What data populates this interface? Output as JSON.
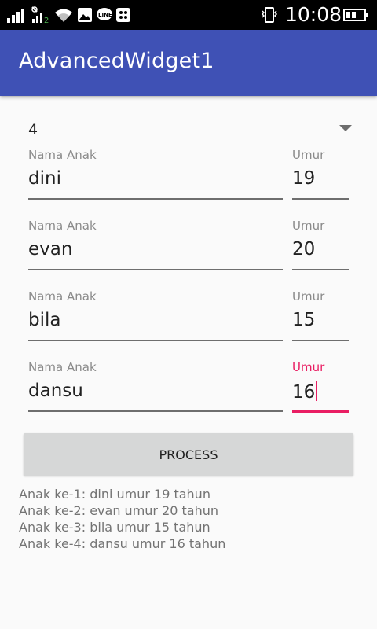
{
  "statusbar": {
    "time": "10:08",
    "icons": [
      "signal-icon",
      "signal-2-icon",
      "wifi-icon",
      "image-icon",
      "line-icon",
      "bbm-icon",
      "chat-icon",
      "vibrate-icon",
      "battery-icon"
    ]
  },
  "appbar": {
    "title": "AdvancedWidget1"
  },
  "spinner": {
    "value": "4"
  },
  "rows": [
    {
      "name_label": "Nama Anak",
      "name": "dini",
      "age_label": "Umur",
      "age": "19"
    },
    {
      "name_label": "Nama Anak",
      "name": "evan",
      "age_label": "Umur",
      "age": "20"
    },
    {
      "name_label": "Nama Anak",
      "name": "bila",
      "age_label": "Umur",
      "age": "15"
    },
    {
      "name_label": "Nama Anak",
      "name": "dansu",
      "age_label": "Umur",
      "age": "16"
    }
  ],
  "button": {
    "label": "PROCESS"
  },
  "output": [
    "Anak ke-1: dini umur 19 tahun",
    "Anak ke-2: evan umur 20 tahun",
    "Anak ke-3: bila umur 15 tahun",
    "Anak ke-4: dansu umur 16 tahun"
  ],
  "colors": {
    "primary": "#3f51b5",
    "accent": "#e91e63",
    "status_bar": "#000000"
  }
}
